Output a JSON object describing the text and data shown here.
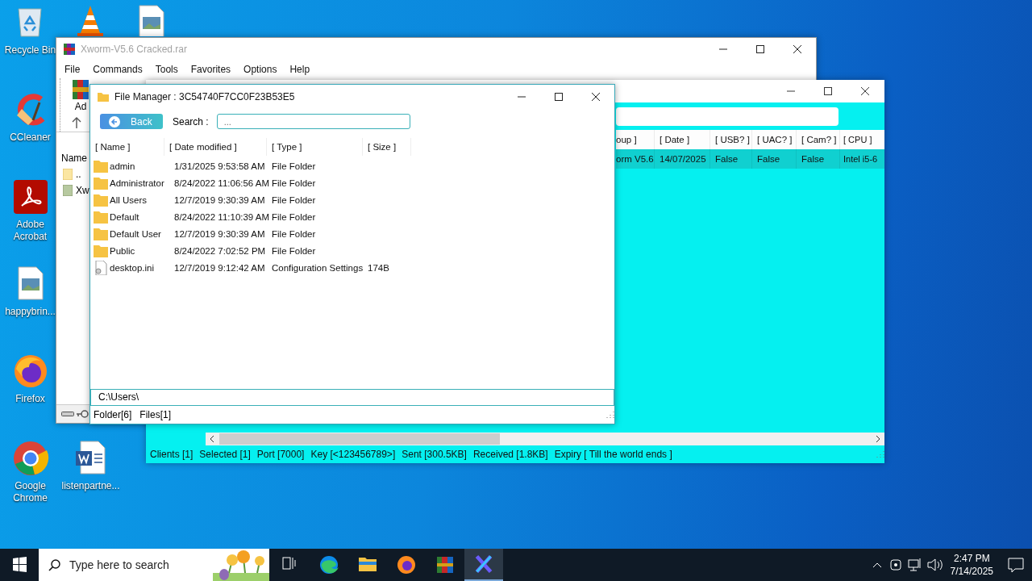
{
  "desktop_icons": [
    {
      "kind": "recycle-bin",
      "label": "Recycle Bin"
    },
    {
      "kind": "cone"
    },
    {
      "kind": "image"
    },
    {
      "kind": "ccleaner",
      "label": "CCleaner"
    },
    {
      "kind": "acrobat",
      "label": "Adobe Acrobat"
    },
    {
      "kind": "image",
      "label": "happybrin..."
    },
    {
      "kind": "firefox",
      "label": "Firefox"
    },
    {
      "kind": "chrome",
      "label": "Google Chrome"
    },
    {
      "kind": "word",
      "label": "listenpartne..."
    }
  ],
  "archive_window": {
    "title": "Xworm-V5.6 Cracked.rar",
    "menu": [
      "File",
      "Commands",
      "Tools",
      "Favorites",
      "Options",
      "Help"
    ],
    "toolbar_button": "Ad",
    "list_header": "Name",
    "files": [
      {
        "kind": "parent",
        "name": ".."
      },
      {
        "kind": "archive",
        "name": "Xw"
      }
    ]
  },
  "builder_window": {
    "columns": [
      "oup ]",
      "[ Date ]",
      "[ USB? ]",
      "[ UAC? ]",
      "[ Cam? ]",
      "[ CPU ]"
    ],
    "rows": [
      {
        "selected": true,
        "cells": [
          "orm V5.6",
          "14/07/2025",
          "False",
          "False",
          "False",
          "Intel i5-6"
        ]
      }
    ],
    "status_bar": [
      "Clients [1]",
      "Selected [1]",
      "Port [7000]",
      "Key [<123456789>]",
      "Sent [300.5KB]",
      "Received [1.8KB]",
      "Expiry [ Till the world ends ]"
    ]
  },
  "file_manager": {
    "title": "File Manager : 3C54740F7CC0F23B53E5",
    "back_button": "Back",
    "search_label": "Search :",
    "search_placeholder": "...",
    "columns": [
      "[ Name ]",
      "[ Date modified ]",
      "[ Type ]",
      "[ Size ]"
    ],
    "rows": [
      {
        "kind": "folder",
        "name": "admin",
        "date": "1/31/2025 9:53:58 AM",
        "type": "File Folder"
      },
      {
        "kind": "folder",
        "name": "Administrator",
        "date": "8/24/2022 11:06:56 AM",
        "type": "File Folder"
      },
      {
        "kind": "folder",
        "name": "All Users",
        "date": "12/7/2019 9:30:39 AM",
        "type": "File Folder"
      },
      {
        "kind": "folder",
        "name": "Default",
        "date": "8/24/2022 11:10:39 AM",
        "type": "File Folder"
      },
      {
        "kind": "folder",
        "name": "Default User",
        "date": "12/7/2019 9:30:39 AM",
        "type": "File Folder"
      },
      {
        "kind": "folder",
        "name": "Public",
        "date": "8/24/2022 7:02:52 PM",
        "type": "File Folder"
      },
      {
        "kind": "file",
        "name": "desktop.ini",
        "date": "12/7/2019 9:12:42 AM",
        "type": "Configuration Settings",
        "size": "174B"
      }
    ],
    "path": "C:\\Users\\",
    "status": [
      "Folder[6]",
      "Files[1]"
    ]
  },
  "taskbar": {
    "search_placeholder": "Type here to search",
    "apps": [
      {
        "kind": "task-view",
        "selected": false
      },
      {
        "kind": "edge",
        "selected": false
      },
      {
        "kind": "explorer",
        "selected": false
      },
      {
        "kind": "firefox",
        "selected": false
      },
      {
        "kind": "winrar",
        "selected": false
      },
      {
        "kind": "xworm",
        "selected": true
      }
    ],
    "time": "2:47 PM",
    "date": "7/14/2025"
  }
}
